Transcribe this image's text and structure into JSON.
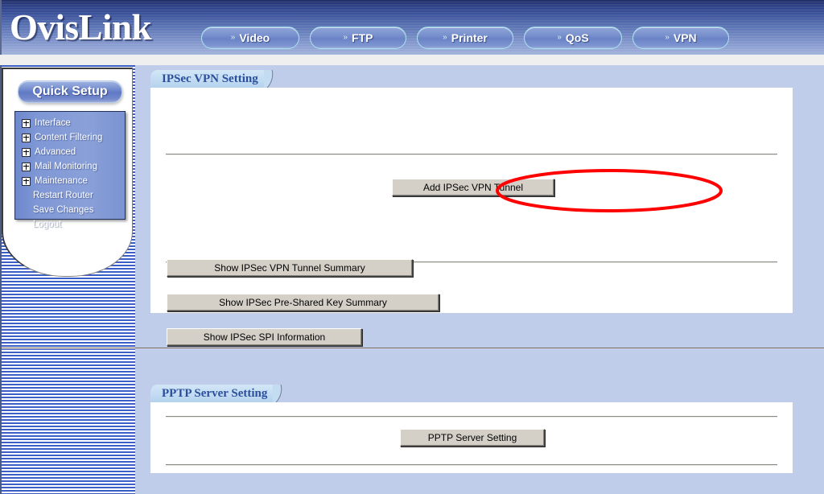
{
  "header": {
    "logo": "OvisLink",
    "nav": [
      {
        "label": "Video",
        "icon": "double-arrow-icon",
        "width": "w-video"
      },
      {
        "label": "FTP",
        "icon": "double-arrow-icon",
        "width": "w-ftp"
      },
      {
        "label": "Printer",
        "icon": "double-arrow-icon",
        "width": "w-printer"
      },
      {
        "label": "QoS",
        "icon": "double-arrow-icon",
        "width": "w-qos"
      },
      {
        "label": "VPN",
        "icon": "double-arrow-icon",
        "width": "w-vpn"
      }
    ],
    "arrow_glyph": "»"
  },
  "sidebar": {
    "quick_setup_label": "Quick Setup",
    "items": [
      {
        "label": "Interface",
        "expandable": true
      },
      {
        "label": "Content Filtering",
        "expandable": true
      },
      {
        "label": "Advanced",
        "expandable": true
      },
      {
        "label": "Mail Monitoring",
        "expandable": true
      },
      {
        "label": "Maintenance",
        "expandable": true
      },
      {
        "label": "Restart Router",
        "expandable": false
      },
      {
        "label": "Save Changes",
        "expandable": false
      },
      {
        "label": "Logout",
        "expandable": false
      }
    ]
  },
  "ipsec_section": {
    "tab_label": "IPSec VPN Setting",
    "buttons": [
      {
        "label": "Add IPSec VPN Tunnel",
        "highlighted": true
      },
      {
        "label": "Show IPSec VPN Tunnel Summary",
        "highlighted": false
      },
      {
        "label": "Show IPSec Pre-Shared Key Summary",
        "highlighted": false
      },
      {
        "label": "Show IPSec SPI Information",
        "highlighted": false
      }
    ]
  },
  "pptp_section": {
    "tab_label": "PPTP Server Setting",
    "buttons": [
      {
        "label": "PPTP Server Setting"
      }
    ]
  },
  "annotation": {
    "type": "ellipse-highlight",
    "color": "#ff0000",
    "target": "Add IPSec VPN Tunnel"
  },
  "colors": {
    "page_background": "#bfcdea",
    "panel_background": "#ffffff",
    "header_dark": "#16255f",
    "header_light": "#9db0da",
    "tab_text": "#2b4f9c",
    "accent_red": "#ff0000",
    "button_face": "#d4d0c8"
  }
}
